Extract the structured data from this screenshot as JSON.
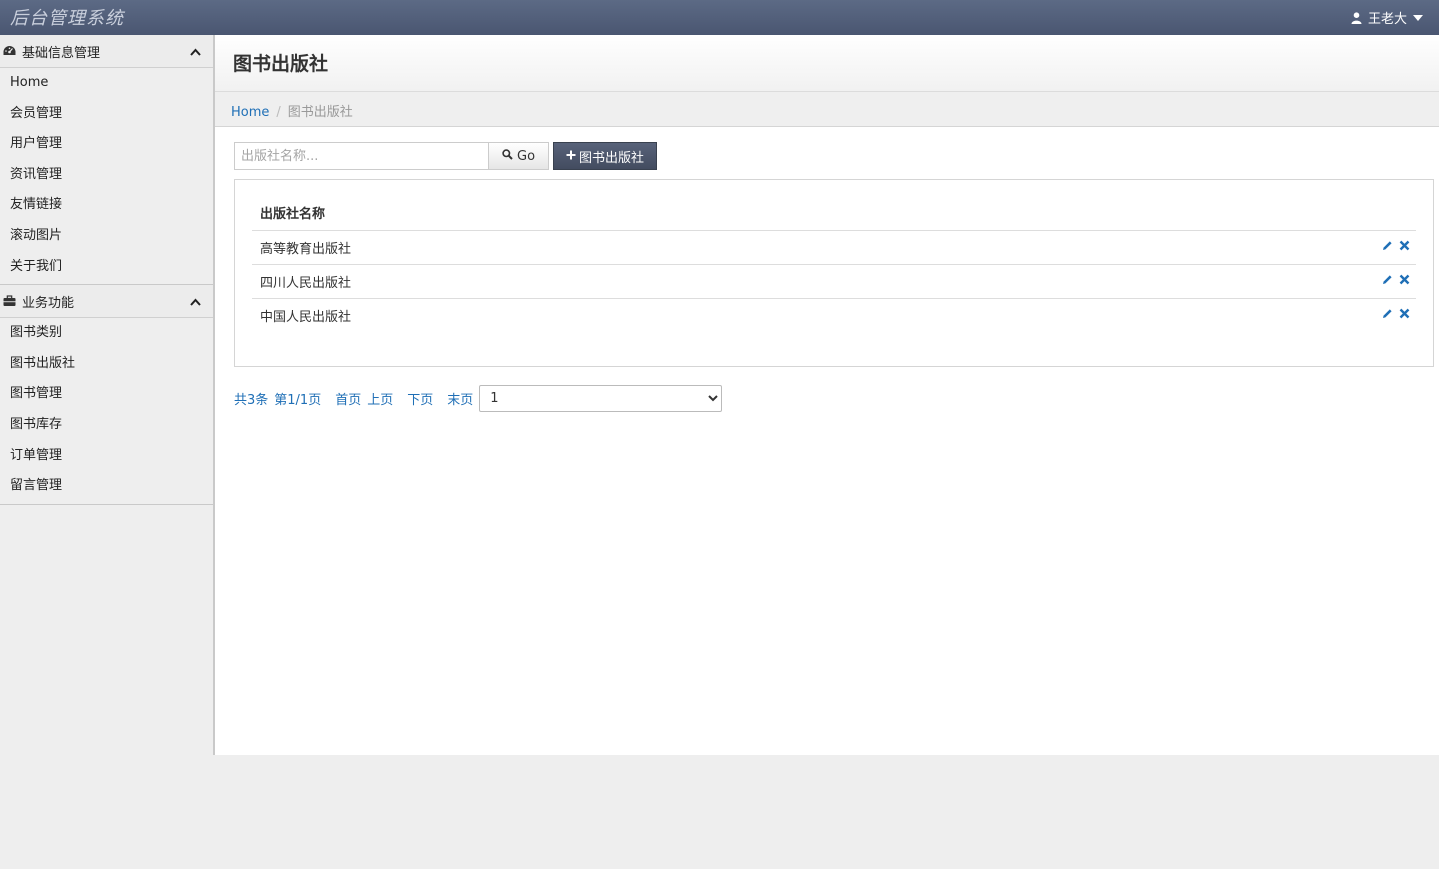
{
  "app": {
    "brand": "后台管理系统",
    "user_name": "王老大"
  },
  "sidebar": {
    "groups": [
      {
        "title": "基础信息管理",
        "icon": "dashboard-icon",
        "items": [
          "Home",
          "会员管理",
          "用户管理",
          "资讯管理",
          "友情链接",
          "滚动图片",
          "关于我们"
        ]
      },
      {
        "title": "业务功能",
        "icon": "briefcase-icon",
        "items": [
          "图书类别",
          "图书出版社",
          "图书管理",
          "图书库存",
          "订单管理",
          "留言管理"
        ]
      }
    ]
  },
  "page": {
    "title": "图书出版社"
  },
  "breadcrumb": {
    "home": "Home",
    "current": "图书出版社"
  },
  "toolbar": {
    "search_placeholder": "出版社名称...",
    "go_label": "Go",
    "add_label": "图书出版社"
  },
  "table": {
    "header": "出版社名称",
    "rows": [
      "高等教育出版社",
      "四川人民出版社",
      "中国人民出版社"
    ]
  },
  "pager": {
    "total": "共3条",
    "page_info": "第1/1页",
    "first": "首页",
    "prev": "上页",
    "next": "下页",
    "last": "末页",
    "selected_page": "1"
  },
  "colors": {
    "navbar": "#4f5b76",
    "link": "#1f6fb6",
    "add_button": "#4a5367"
  }
}
